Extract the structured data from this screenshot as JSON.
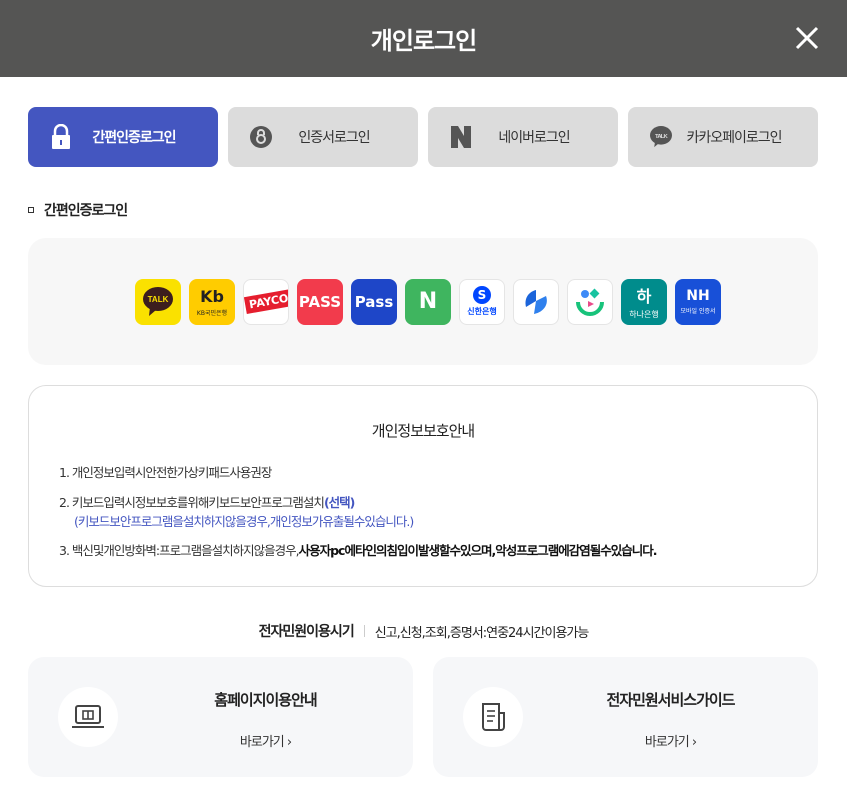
{
  "header": {
    "title": "개인로그인",
    "close_icon": "close-icon"
  },
  "tabs": [
    {
      "label": "간편인증로그인",
      "icon": "lock-icon",
      "active": true
    },
    {
      "label": "인증서로그인",
      "icon": "certificate-icon",
      "active": false
    },
    {
      "label": "네이버로그인",
      "icon": "naver-icon",
      "active": false
    },
    {
      "label": "카카오페이로그인",
      "icon": "kakao-talk-icon",
      "active": false
    }
  ],
  "section_title": "간편인증로그인",
  "providers": [
    {
      "name": "kakao",
      "logo": "TALK",
      "color": "#FAE100"
    },
    {
      "name": "kb",
      "logo": "Kb",
      "caption": "KB국민은행",
      "color": "#FFCC00"
    },
    {
      "name": "payco",
      "logo": "PAYCO",
      "color": "#E51E2E"
    },
    {
      "name": "pass-red",
      "logo": "PASS",
      "color": "#F23B4C"
    },
    {
      "name": "pass-blue",
      "logo": "Pass",
      "color": "#1E46C8"
    },
    {
      "name": "naver",
      "logo": "N",
      "color": "#3FB55F"
    },
    {
      "name": "shinhan",
      "logo": "S",
      "caption": "신한은행",
      "color": "#0046FF"
    },
    {
      "name": "toss",
      "logo": "",
      "color": "#1B64DA"
    },
    {
      "name": "banksalad",
      "logo": "",
      "color": "#18C37B"
    },
    {
      "name": "hana",
      "logo": "하",
      "caption": "하나은행",
      "color": "#008C8C"
    },
    {
      "name": "nh",
      "logo": "NH",
      "caption": "모바일 인증서",
      "color": "#1850D8"
    }
  ],
  "privacy": {
    "title": "개인정보보호안내",
    "items": [
      {
        "num": "1.",
        "text": "개인정보입력시안전한가상키패드사용권장"
      },
      {
        "num": "2.",
        "text": "키보드입력시정보보호를위해키보드보안프로그램설치",
        "highlight": "(선택)",
        "sub": "(키보드보안프로그램을설치하지않을경우,개인정보가유출될수있습니다.)"
      },
      {
        "num": "3.",
        "text": "백신및개인방화벽:프로그램을설치하지않을경우,",
        "bold": "사용자pc에타인의침입이발생할수있으며,악성프로그램에감염될수있습니다."
      }
    ]
  },
  "hours": {
    "title": "전자민원이용시기",
    "text": "신고,신청,조회,증명서:연중24시간이용가능"
  },
  "cards": [
    {
      "title": "홈페이지이용안내",
      "link": "바로가기 ›",
      "icon": "laptop-icon"
    },
    {
      "title": "전자민원서비스가이드",
      "link": "바로가기 ›",
      "icon": "document-icon"
    }
  ],
  "accent": "#4456C0"
}
